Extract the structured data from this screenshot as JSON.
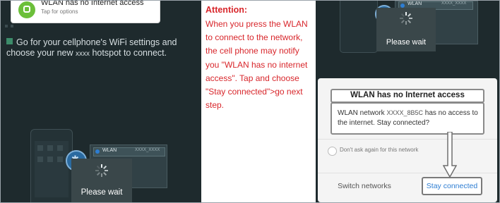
{
  "left_panel": {
    "notification": {
      "title": "WLAN has no Internet access",
      "subtitle": "Tap for options"
    },
    "instruction": {
      "part1": "Go for your cellphone's WiFi settings and choose your new",
      "ssid": "xxxx",
      "part2": "hotspot to connect."
    },
    "wlan_row": {
      "label": "WLAN",
      "ssid": "XXXX_XXXX"
    },
    "loading": {
      "label": "Please wait"
    }
  },
  "middle_panel": {
    "title": "Attention:",
    "body": "When you press the WLAN to connect to the network, the cell phone may notify you \"WLAN has no internet access\". Tap and choose \"Stay connected\">go next step."
  },
  "right_panel": {
    "wlan_row": {
      "label": "WLAN",
      "ssid": "XXXX_XXXX"
    },
    "loading": {
      "label": "Please wait"
    },
    "dialog": {
      "title": "WLAN has no Internet access",
      "message_part1": "WLAN network",
      "network_name": "XXXX_8B5C",
      "message_part2": "has no access to the internet. Stay connected?",
      "checkbox_label": "Don't ask again for this network",
      "switch_button": "Switch networks",
      "stay_button": "Stay connected"
    }
  },
  "colors": {
    "phone_bg": "#1e2a2d",
    "attention_red": "#d8262b",
    "accent_blue": "#2d7dd2",
    "dialog_bg": "#f4f4f4"
  }
}
